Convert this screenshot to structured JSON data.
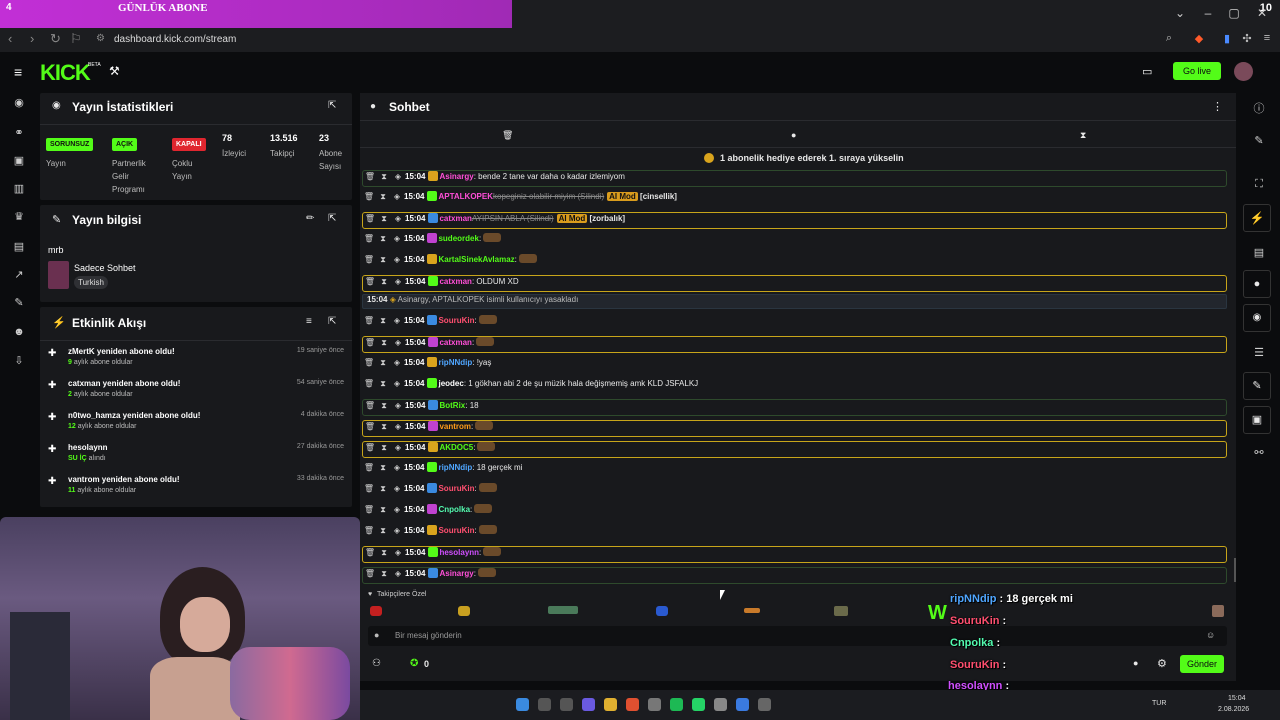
{
  "subgoal": {
    "current": "4",
    "title": "GÜNLÜK ABONE",
    "goal": "10",
    "progress": 0.4
  },
  "browser": {
    "url": "dashboard.kick.com/stream"
  },
  "header": {
    "go_live": "Go live",
    "logo": "KICK",
    "beta": "BETA"
  },
  "stats": {
    "title": "Yayın İstatistikleri",
    "items": [
      {
        "badge": "SORUNSUZ",
        "badge_color": "#53fc18",
        "label": "Yayın"
      },
      {
        "badge": "AÇIK",
        "badge_color": "#53fc18",
        "label": "Partnerlik Gelir Programı"
      },
      {
        "badge": "KAPALI",
        "badge_color": "#e0262f",
        "label": "Çoklu Yayın"
      },
      {
        "value": "78",
        "label": "İzleyici"
      },
      {
        "value": "13.516",
        "label": "Takipçi"
      },
      {
        "value": "23",
        "label": "Abone Sayısı"
      }
    ]
  },
  "info": {
    "title": "Yayın bilgisi",
    "stream_title": "mrb",
    "category": "Sadece Sohbet",
    "language": "Turkish"
  },
  "activity": {
    "title": "Etkinlik Akışı",
    "items": [
      {
        "title": "zMertK yeniden abone oldu!",
        "num": "9",
        "sub": "aylık abone oldular",
        "time": "19 saniye önce"
      },
      {
        "title": "catxman yeniden abone oldu!",
        "num": "2",
        "sub": "aylık abone oldular",
        "time": "54 saniye önce"
      },
      {
        "title": "n0two_hamza yeniden abone oldu!",
        "num": "12",
        "sub": "aylık abone oldular",
        "time": "4 dakika önce"
      },
      {
        "title": "hesolaynn",
        "num": "SU İÇ",
        "sub": "alındı",
        "time": "27 dakika önce"
      },
      {
        "title": "vantrom yeniden abone oldu!",
        "num": "11",
        "sub": "aylık abone oldular",
        "time": "33 dakika önce"
      }
    ]
  },
  "chat": {
    "title": "Sohbet",
    "pinned": "1 abonelik hediye ederek 1. sıraya yükselin",
    "followers_only": "Takipçilere Özel",
    "input_placeholder": "Bir mesaj gönderin",
    "send": "Gönder",
    "count": "0",
    "ban_notice": {
      "time": "15:04",
      "text": "Asinargy, APTALKOPEK isimli kullanıcıyı yasakladı"
    },
    "messages": [
      {
        "time": "15:04",
        "user": "Asinargy",
        "color": "#ff4fd8",
        "text": ": bende 2 tane var daha o kadar izlemiyom",
        "style": "green"
      },
      {
        "time": "15:04",
        "user": "APTALKOPEK",
        "color": "#ff4fd8",
        "text": "kopeginiz olabilir miyim (Silindi)",
        "tag": "AI Mod",
        "extra": "[cinsellik]",
        "style": "none",
        "deleted": true
      },
      {
        "time": "15:04",
        "user": "catxman",
        "color": "#ff4fd8",
        "text": "AYIPSIN ABLA (Silindi)",
        "tag": "AI Mod",
        "extra": "[zorbalık]",
        "style": "gold",
        "deleted": true
      },
      {
        "time": "15:04",
        "user": "sudeordek",
        "color": "#53fc18",
        "text": ":",
        "style": "none"
      },
      {
        "time": "15:04",
        "user": "KartalSinekAvlamaz",
        "color": "#53fc18",
        "text": ":",
        "style": "none"
      },
      {
        "time": "15:04",
        "user": "catxman",
        "color": "#ff4fd8",
        "text": ": OLDUM XD",
        "style": "gold"
      },
      {
        "time": "15:04",
        "user": "SouruKin",
        "color": "#ff4f6f",
        "text": ":",
        "style": "none"
      },
      {
        "time": "15:04",
        "user": "catxman",
        "color": "#ff4fd8",
        "text": ":",
        "style": "gold"
      },
      {
        "time": "15:04",
        "user": "ripNNdip",
        "color": "#4fa6ff",
        "text": ": !yaş",
        "style": "none"
      },
      {
        "time": "15:04",
        "user": "jeodec",
        "color": "#ffffff",
        "text": ": 1 gökhan abi 2 de şu müzik hala değişmemiş amk KLD JSFALKJ",
        "style": "none"
      },
      {
        "time": "15:04",
        "user": "BotRix",
        "color": "#53fc18",
        "text": ": 18",
        "style": "green"
      },
      {
        "time": "15:04",
        "user": "vantrom",
        "color": "#ff9c1a",
        "text": ":",
        "style": "gold"
      },
      {
        "time": "15:04",
        "user": "AKDOC5",
        "color": "#53fc18",
        "text": ":",
        "style": "gold"
      },
      {
        "time": "15:04",
        "user": "ripNNdip",
        "color": "#4fa6ff",
        "text": ": 18 gerçek mi",
        "style": "none"
      },
      {
        "time": "15:04",
        "user": "SouruKin",
        "color": "#ff4f6f",
        "text": ":",
        "style": "none"
      },
      {
        "time": "15:04",
        "user": "Cnpolka",
        "color": "#53fcb0",
        "text": ":",
        "style": "none"
      },
      {
        "time": "15:04",
        "user": "SouruKin",
        "color": "#ff4f6f",
        "text": ":",
        "style": "none"
      },
      {
        "time": "15:04",
        "user": "hesolaynn",
        "color": "#d04fff",
        "text": ":",
        "style": "gold"
      },
      {
        "time": "15:04",
        "user": "Asinargy",
        "color": "#ff4fd8",
        "text": ":",
        "style": "green"
      }
    ]
  },
  "overlay": [
    {
      "user": "ripNNdip",
      "color": "#4fa6ff",
      "text": ": 18 gerçek mi"
    },
    {
      "user": "SouruKin",
      "color": "#ff4f6f",
      "text": ":"
    },
    {
      "user": "Cnpolka",
      "color": "#53fcb0",
      "text": ":"
    },
    {
      "user": "SouruKin",
      "color": "#ff4f6f",
      "text": ":"
    },
    {
      "user": "hesolaynn",
      "color": "#d04fff",
      "text": ":"
    },
    {
      "user": "Asinargy",
      "color": "#ff4fd8",
      "text": ":"
    }
  ],
  "taskbar": {
    "lang": "TUR",
    "time": "15:04",
    "date": "2.08.2026"
  }
}
